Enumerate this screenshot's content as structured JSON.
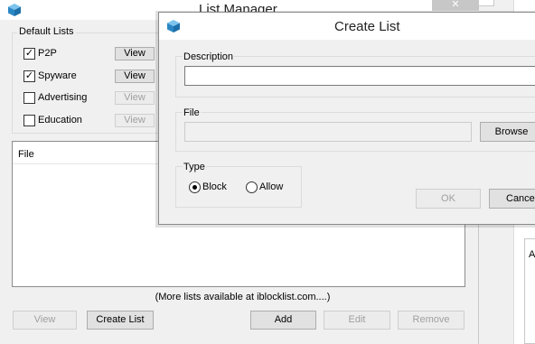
{
  "list_manager": {
    "title": "List Manager",
    "close_glyph": "✕",
    "default_lists": {
      "legend": "Default Lists",
      "items": [
        {
          "label": "P2P",
          "checked": true,
          "view_label": "View",
          "view_enabled": true
        },
        {
          "label": "Spyware",
          "checked": true,
          "view_label": "View",
          "view_enabled": true
        },
        {
          "label": "Advertising",
          "checked": false,
          "view_label": "View",
          "view_enabled": false
        },
        {
          "label": "Education",
          "checked": false,
          "view_label": "View",
          "view_enabled": false
        }
      ]
    },
    "files_column_header": "File",
    "more_lists_note": "(More lists available at iblocklist.com....)",
    "buttons": {
      "view": "View",
      "create_list": "Create List",
      "add": "Add",
      "edit": "Edit",
      "remove": "Remove"
    },
    "right_panel_label": "A"
  },
  "create_list": {
    "title": "Create List",
    "description": {
      "legend": "Description",
      "value": ""
    },
    "file": {
      "legend": "File",
      "value": "",
      "browse_label": "Browse"
    },
    "type": {
      "legend": "Type",
      "options": [
        {
          "label": "Block",
          "selected": true
        },
        {
          "label": "Allow",
          "selected": false
        }
      ]
    },
    "ok_label": "OK",
    "cancel_label": "Cancel"
  },
  "colors": {
    "icon_cube": "#3a9ad9",
    "window_bg": "#f0f0f0",
    "titlebar_bg": "#ffffff",
    "disabled_text": "#a0a0a0"
  }
}
